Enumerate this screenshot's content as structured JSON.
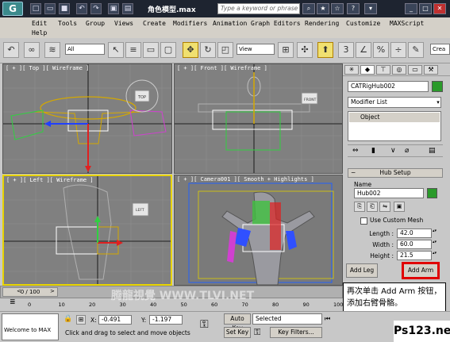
{
  "window": {
    "title": "角色模型.max",
    "search_placeholder": "Type a keyword or phrase"
  },
  "menu": [
    "Edit",
    "Tools",
    "Group",
    "Views",
    "Create",
    "Modifiers",
    "Animation",
    "Graph Editors",
    "Rendering",
    "Customize",
    "MAXScript",
    "Help"
  ],
  "toolbar": {
    "filter_select": "All",
    "view_select": "View",
    "create_label": "Crea"
  },
  "viewports": {
    "top": {
      "label": "[ + ][ Top ][ Wireframe ]",
      "cube": "TOP"
    },
    "front": {
      "label": "[ + ][ Front ][ Wireframe ]",
      "cube": "FRONT"
    },
    "left": {
      "label": "[ + ][ Left ][ Wireframe ]",
      "cube": "LEFT"
    },
    "camera": {
      "label": "[ + ][ Camera001 ][ Smooth + Highlights ]"
    }
  },
  "command_panel": {
    "object_name": "CATRigHub002",
    "modifier_list": "Modifier List",
    "stack_item": "Object",
    "rollout_title": "Hub Setup",
    "name_label": "Name",
    "name_value": "Hub002",
    "use_custom_mesh": "Use Custom Mesh",
    "length_label": "Length :",
    "length_value": "42.0",
    "width_label": "Width :",
    "width_value": "60.0",
    "height_label": "Height :",
    "height_value": "21.5",
    "add_leg": "Add Leg",
    "add_arm": "Add Arm"
  },
  "timeline": {
    "frame": "0 / 100"
  },
  "ruler_ticks": [
    "0",
    "10",
    "20",
    "30",
    "40",
    "50",
    "60",
    "70",
    "80",
    "90",
    "100"
  ],
  "status": {
    "welcome": "Welcome to MAX",
    "x_label": "X:",
    "x_value": "-0.491",
    "y_label": "Y:",
    "y_value": "-1.197",
    "autokey": "Auto Key",
    "selected": "Selected",
    "setkey": "Set Key",
    "keyfilters": "Key Filters...",
    "prompt": "Click and drag to select and move objects"
  },
  "overlay_text": "再次单击 Add Arm 按钮，添加右臂骨骼。",
  "watermark": "Ps123.net",
  "watermark_middle": "腾龍視覺 WWW.TLVI.NET",
  "colors": {
    "accent_green": "#2a9a2a",
    "highlight_red": "#e00000",
    "active_viewport": "#e8d400"
  }
}
